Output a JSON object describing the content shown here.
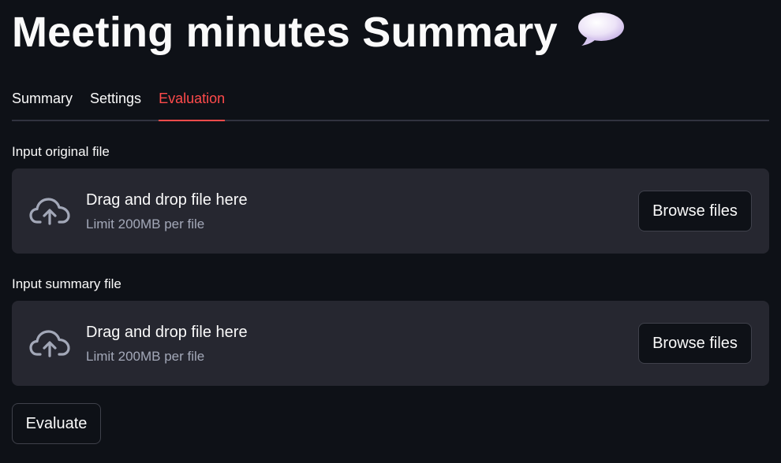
{
  "page": {
    "title": "Meeting minutes Summary",
    "title_emoji_icon": "speech-balloon-icon"
  },
  "tabs": [
    {
      "label": "Summary",
      "active": false
    },
    {
      "label": "Settings",
      "active": false
    },
    {
      "label": "Evaluation",
      "active": true
    }
  ],
  "uploaders": [
    {
      "label": "Input original file",
      "drop_text": "Drag and drop file here",
      "limit_text": "Limit 200MB per file",
      "button_label": "Browse files",
      "icon": "cloud-upload-icon"
    },
    {
      "label": "Input summary file",
      "drop_text": "Drag and drop file here",
      "limit_text": "Limit 200MB per file",
      "button_label": "Browse files",
      "icon": "cloud-upload-icon"
    }
  ],
  "actions": {
    "evaluate_label": "Evaluate"
  },
  "colors": {
    "background": "#0e1117",
    "accent": "#ff4b4b",
    "dropzone": "#262730",
    "muted_text": "#a3a8b8"
  }
}
